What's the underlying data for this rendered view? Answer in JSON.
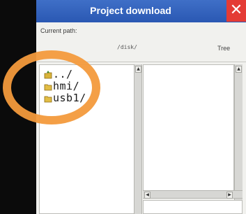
{
  "window": {
    "title": "Project download",
    "close_glyph": "✕"
  },
  "path": {
    "label": "Current path:",
    "value": "/disk/"
  },
  "tree": {
    "label": "Tree"
  },
  "files": [
    {
      "name": "../",
      "icon": "folder-up-icon"
    },
    {
      "name": "hmi/",
      "icon": "folder-icon"
    },
    {
      "name": "usb1/",
      "icon": "folder-icon"
    }
  ],
  "colors": {
    "titlebar": "#2f5fbd",
    "close": "#e43b35",
    "annotation_ring": "#f39a3c"
  }
}
